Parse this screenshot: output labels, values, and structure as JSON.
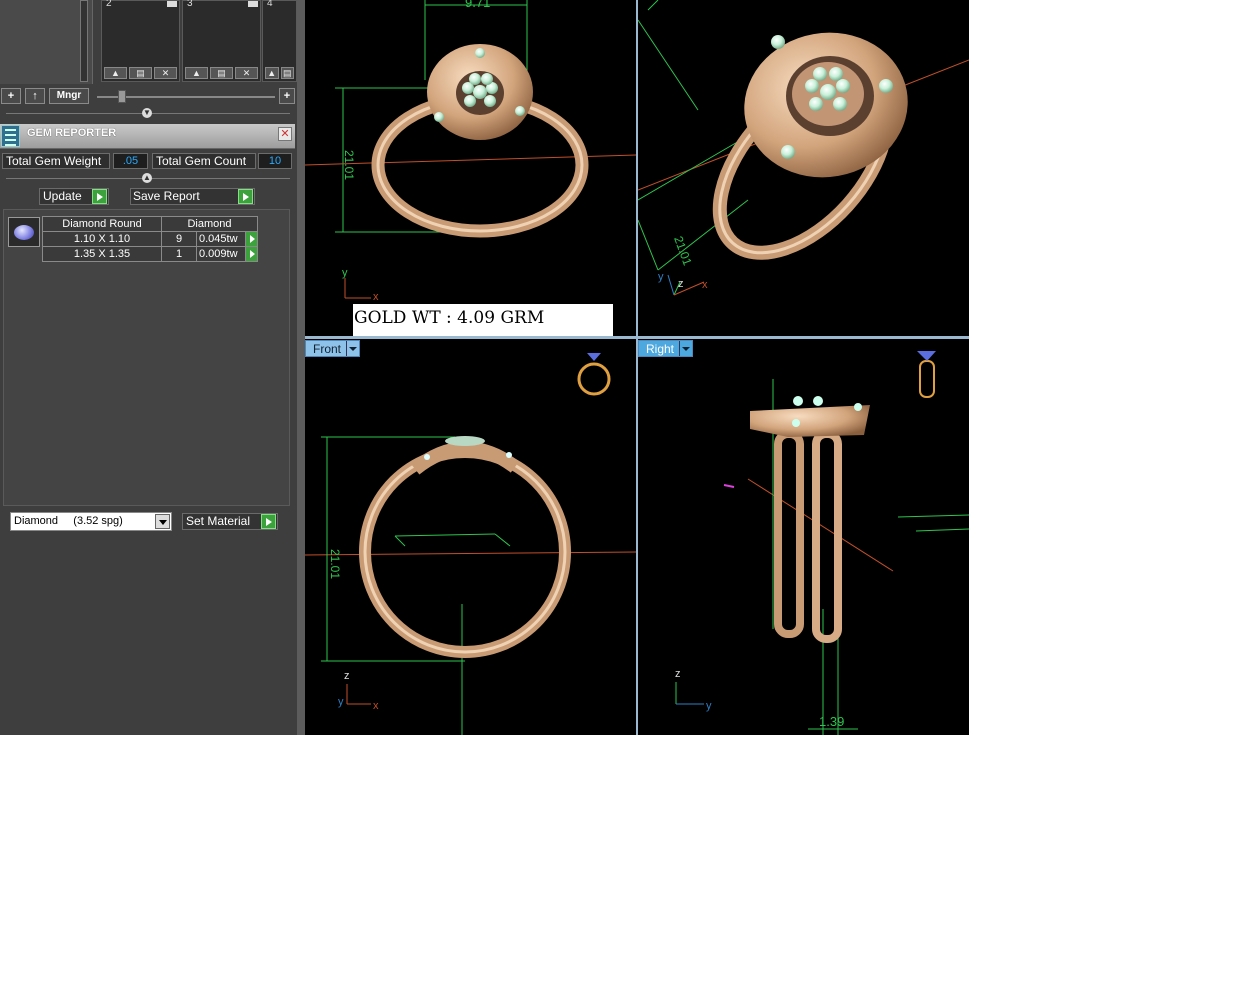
{
  "slots": [
    {
      "num": "2"
    },
    {
      "num": "3"
    },
    {
      "num": "4"
    }
  ],
  "toolbar": {
    "mngr_label": "Mngr"
  },
  "gem_reporter": {
    "title": "GEM REPORTER",
    "total_weight_label": "Total Gem Weight",
    "total_weight_value": ".05",
    "total_count_label": "Total Gem Count",
    "total_count_value": "10",
    "update_label": "Update",
    "save_report_label": "Save Report",
    "table": {
      "headers": [
        "Diamond Round",
        "Diamond"
      ],
      "rows": [
        {
          "size": "1.10 X 1.10",
          "qty": "9",
          "weight": "0.045tw"
        },
        {
          "size": "1.35 X 1.35",
          "qty": "1",
          "weight": "0.009tw"
        }
      ]
    },
    "material_value": "Diamond     (3.52 spg)",
    "set_material_label": "Set Material"
  },
  "viewports": {
    "top": {
      "dim_width": "9.71",
      "dim_height": "21.01",
      "axes": [
        "y",
        "x"
      ]
    },
    "perspective": {
      "dim": "21.01",
      "axes": [
        "y",
        "z",
        "x"
      ]
    },
    "front": {
      "tab_label": "Front",
      "dim_height": "21.01",
      "axes": [
        "z",
        "y",
        "x"
      ]
    },
    "right": {
      "tab_label": "Right",
      "dim": "1.39",
      "axes": [
        "z",
        "y"
      ]
    }
  },
  "gold_weight": "GOLD WT : 4.09 GRM",
  "colors": {
    "panel_bg": "#3e3e3e",
    "value_blue": "#29aaff",
    "go_green": "#3ca23c",
    "dim_green": "#2ec44e",
    "gold": "#d9b48f"
  }
}
